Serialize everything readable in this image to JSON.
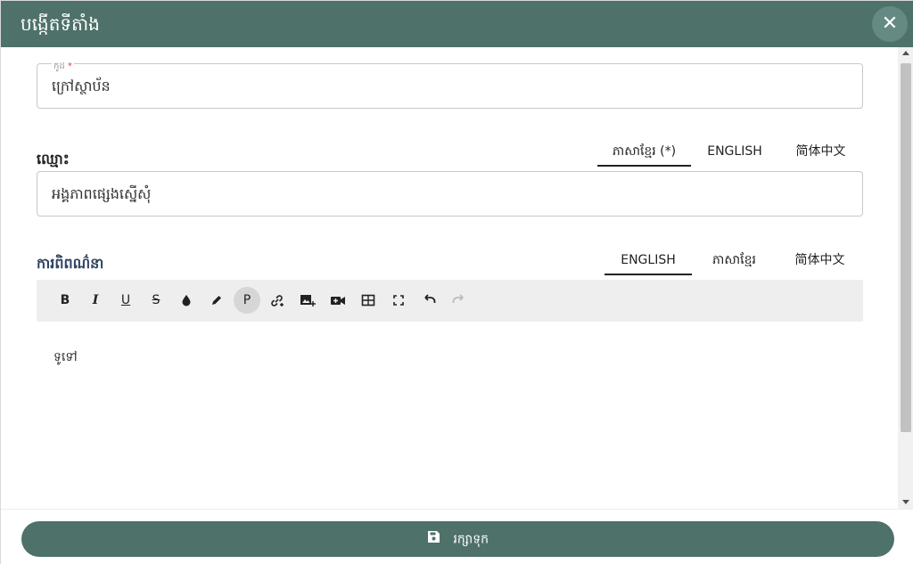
{
  "dialog": {
    "title": "បង្កើតទីតាំង",
    "close_icon": "close-icon"
  },
  "code_field": {
    "label": "កូដ",
    "required_mark": "*",
    "value": "ក្រៅស្ថាប័ន"
  },
  "name_section": {
    "label": "ឈ្មោះ",
    "tabs": [
      {
        "label": "ភាសាខ្មែរ (*)",
        "active": true
      },
      {
        "label": "ENGLISH",
        "active": false
      },
      {
        "label": "简体中文",
        "active": false
      }
    ],
    "value": "អង្គភាពផ្សេងស្នើសុំ"
  },
  "description_section": {
    "label": "ការពិពណ៌នា",
    "tabs": [
      {
        "label": "ENGLISH",
        "active": true
      },
      {
        "label": "ភាសាខ្មែរ",
        "active": false
      },
      {
        "label": "简体中文",
        "active": false
      }
    ],
    "toolbar": [
      {
        "name": "bold",
        "glyph": "B"
      },
      {
        "name": "italic",
        "glyph": "I"
      },
      {
        "name": "underline",
        "glyph": "U"
      },
      {
        "name": "strikethrough",
        "glyph": "S"
      },
      {
        "name": "text-color-icon",
        "glyph": "💧"
      },
      {
        "name": "highlight-icon",
        "glyph": "✎"
      },
      {
        "name": "paragraph",
        "glyph": "P"
      },
      {
        "name": "insert-link-icon",
        "glyph": "🔗"
      },
      {
        "name": "insert-image-icon",
        "glyph": "🖼"
      },
      {
        "name": "insert-video-icon",
        "glyph": "🎥"
      },
      {
        "name": "insert-table-icon",
        "glyph": "⊞"
      },
      {
        "name": "fullscreen-icon",
        "glyph": "⛶"
      },
      {
        "name": "undo-icon",
        "glyph": "↶"
      },
      {
        "name": "redo-icon",
        "glyph": "↷"
      }
    ],
    "editor_text": "ទូទៅ"
  },
  "footer": {
    "save_label": "រក្សាទុក",
    "save_icon": "floppy-disk-icon"
  },
  "colors": {
    "header_bg": "#4e716a",
    "button_bg": "#4e716a",
    "toolbar_bg": "#eeeeee"
  }
}
